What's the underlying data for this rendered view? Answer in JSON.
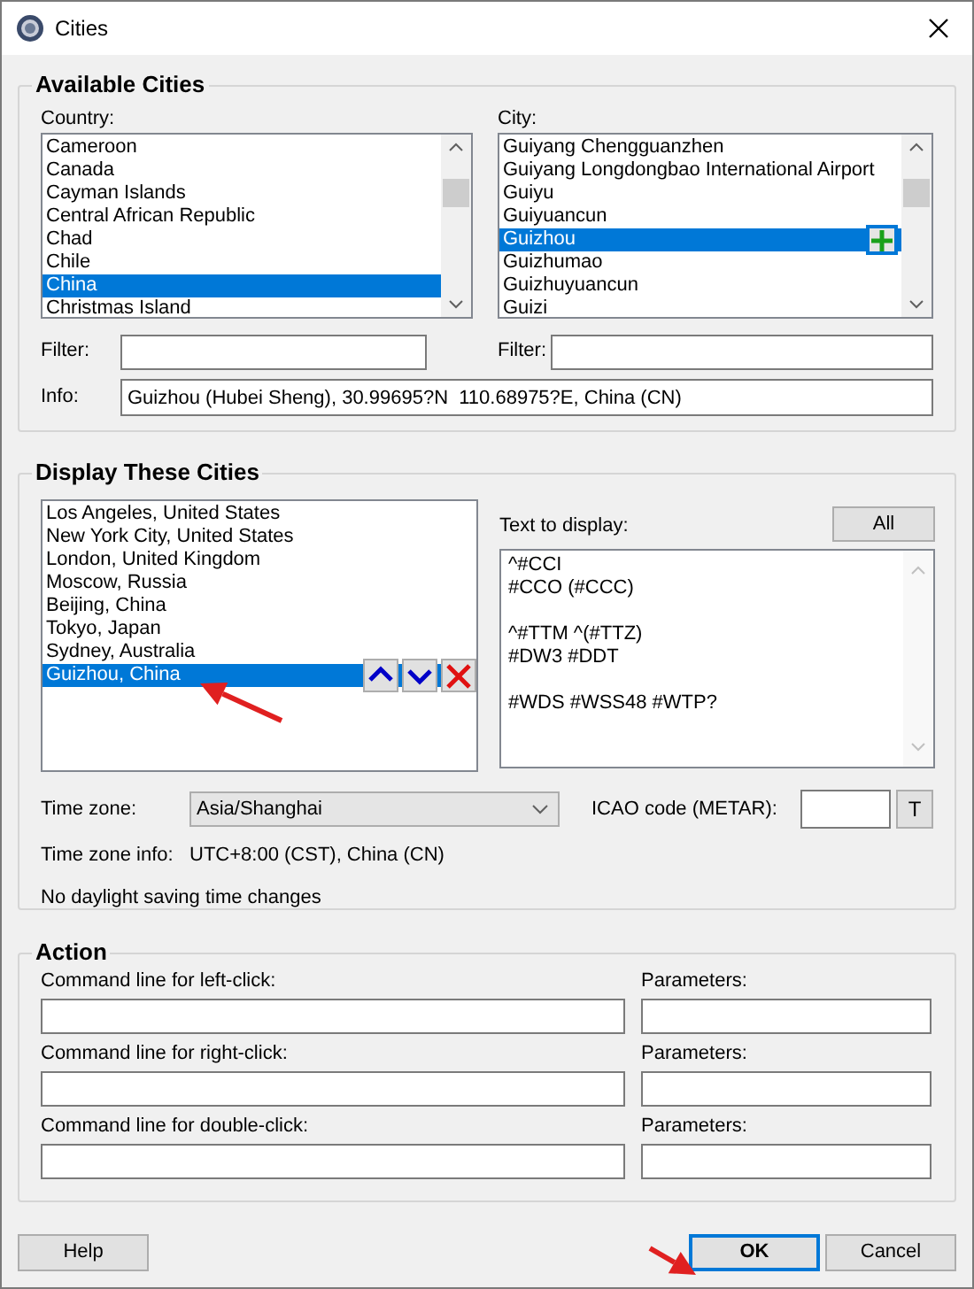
{
  "window": {
    "title": "Cities"
  },
  "available_cities": {
    "title": "Available Cities",
    "country_label": "Country:",
    "countries": [
      {
        "label": "Cameroon",
        "selected": false
      },
      {
        "label": "Canada",
        "selected": false
      },
      {
        "label": "Cayman Islands",
        "selected": false
      },
      {
        "label": "Central African Republic",
        "selected": false
      },
      {
        "label": "Chad",
        "selected": false
      },
      {
        "label": "Chile",
        "selected": false
      },
      {
        "label": "China",
        "selected": true
      },
      {
        "label": "Christmas Island",
        "selected": false
      }
    ],
    "city_label": "City:",
    "cities": [
      {
        "label": "Guiyang Chengguanzhen",
        "selected": false
      },
      {
        "label": "Guiyang Longdongbao International Airport",
        "selected": false
      },
      {
        "label": "Guiyu",
        "selected": false
      },
      {
        "label": "Guiyuancun",
        "selected": false
      },
      {
        "label": "Guizhou",
        "selected": true
      },
      {
        "label": "Guizhumao",
        "selected": false
      },
      {
        "label": "Guizhuyuancun",
        "selected": false
      },
      {
        "label": "Guizi",
        "selected": false
      }
    ],
    "country_filter_label": "Filter:",
    "city_filter_label": "Filter:",
    "info_label": "Info:",
    "info_value": "Guizhou (Hubei Sheng), 30.99695?N  110.68975?E, China (CN)"
  },
  "display_cities": {
    "title": "Display These Cities",
    "cities": [
      {
        "label": "Los Angeles, United States",
        "selected": false
      },
      {
        "label": "New York City, United States",
        "selected": false
      },
      {
        "label": "London, United Kingdom",
        "selected": false
      },
      {
        "label": "Moscow, Russia",
        "selected": false
      },
      {
        "label": "Beijing, China",
        "selected": false
      },
      {
        "label": "Tokyo, Japan",
        "selected": false
      },
      {
        "label": "Sydney, Australia",
        "selected": false
      },
      {
        "label": "Guizhou, China",
        "selected": true
      }
    ],
    "text_label": "Text to display:",
    "all_button": "All",
    "text_value": "^#CCI\n#CCO (#CCC)\n\n^#TTM ^(#TTZ)\n#DW3 #DDT\n\n#WDS #WSS48 #WTP?",
    "timezone_label": "Time zone:",
    "timezone_value": "Asia/Shanghai",
    "icao_label": "ICAO code (METAR):",
    "icao_button": "T",
    "timezone_info_label": "Time zone info:",
    "timezone_info_value": "UTC+8:00 (CST), China (CN)",
    "dst_note": "No daylight saving time changes"
  },
  "action": {
    "title": "Action",
    "rows": [
      {
        "label": "Command line for left-click:",
        "params_label": "Parameters:"
      },
      {
        "label": "Command line for right-click:",
        "params_label": "Parameters:"
      },
      {
        "label": "Command line for double-click:",
        "params_label": "Parameters:"
      }
    ]
  },
  "buttons": [
    {
      "label": "Help",
      "kind": "plain",
      "default": false
    },
    {
      "label": "OK",
      "kind": "right",
      "default": true
    },
    {
      "label": "Cancel",
      "kind": "right",
      "default": false
    }
  ]
}
